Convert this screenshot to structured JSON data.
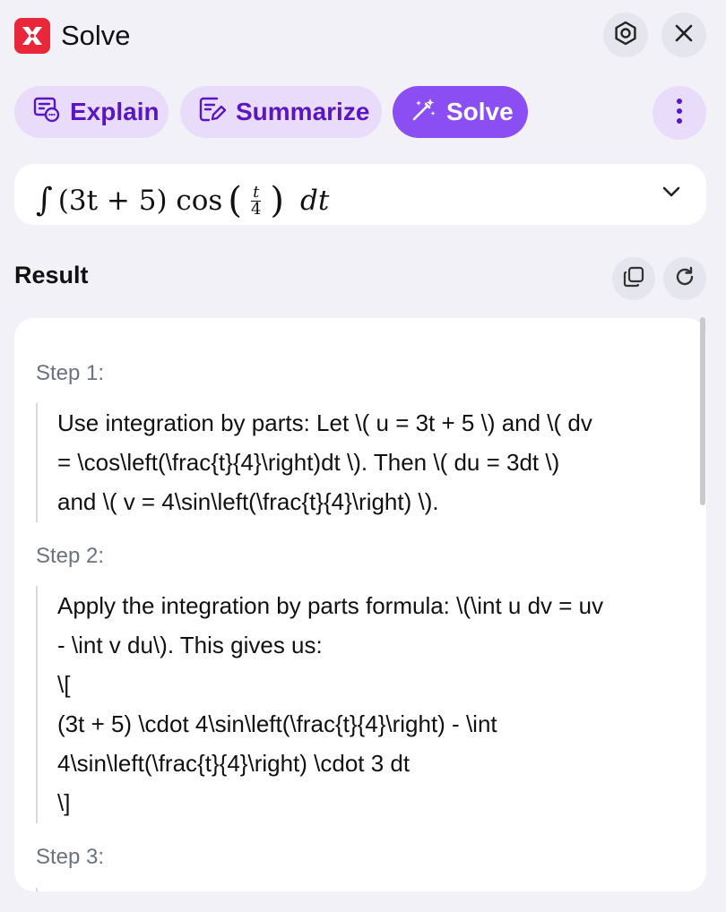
{
  "header": {
    "title": "Solve",
    "icons": [
      "app-logo-icon",
      "settings-icon",
      "close-icon"
    ]
  },
  "actions": {
    "explain_label": "Explain",
    "summarize_label": "Summarize",
    "solve_label": "Solve"
  },
  "expression": {
    "integral": "∫",
    "prefix": "(3t + 5) cos",
    "frac_num": "t",
    "frac_den": "4",
    "suffix": "dt"
  },
  "result": {
    "label": "Result",
    "steps": [
      {
        "title": "Step 1:",
        "lines": [
          "Use integration by parts: Let \\( u = 3t + 5 \\) and \\( dv",
          "= \\cos\\left(\\frac{t}{4}\\right)dt \\). Then \\( du = 3dt \\)",
          "and \\( v = 4\\sin\\left(\\frac{t}{4}\\right) \\)."
        ]
      },
      {
        "title": "Step 2:",
        "lines": [
          "Apply the integration by parts formula: \\(\\int u dv = uv",
          "- \\int v du\\). This gives us:",
          "\\[",
          "(3t + 5) \\cdot 4\\sin\\left(\\frac{t}{4}\\right) - \\int",
          "4\\sin\\left(\\frac{t}{4}\\right) \\cdot 3 dt",
          "\\]"
        ]
      },
      {
        "title": "Step 3:",
        "lines": []
      }
    ]
  },
  "colors": {
    "brand_red": "#e8283a",
    "accent_purple": "#8a4ef3",
    "pill_bg": "#e8dcfa",
    "pill_text": "#5b16c4",
    "background": "#f1f1f7"
  }
}
